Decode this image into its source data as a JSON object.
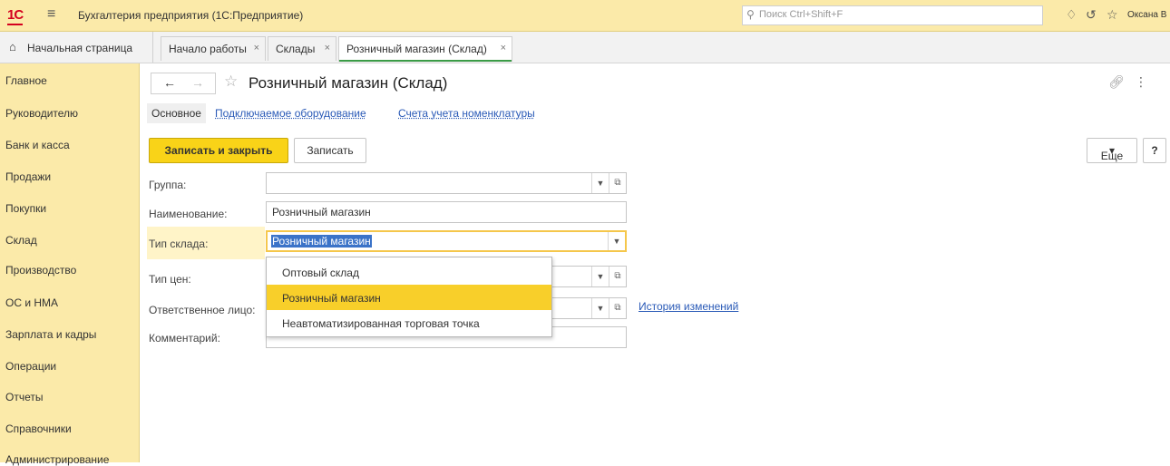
{
  "app": {
    "logo_text": "1С",
    "title": "Бухгалтерия предприятия (1С:Предприятие)",
    "search_placeholder": "Поиск Ctrl+Shift+F",
    "user_name": "Оксана В"
  },
  "tabs": {
    "home_label": "Начальная страница",
    "items": [
      {
        "label": "Начало работы",
        "close": "×"
      },
      {
        "label": "Склады",
        "close": "×"
      },
      {
        "label": "Розничный магазин (Склад)",
        "close": "×"
      }
    ]
  },
  "sidebar": {
    "items": [
      {
        "label": "Главное"
      },
      {
        "label": "Руководителю"
      },
      {
        "label": "Банк и касса"
      },
      {
        "label": "Продажи"
      },
      {
        "label": "Покупки"
      },
      {
        "label": "Склад"
      },
      {
        "label": "Производство"
      },
      {
        "label": "ОС и НМА"
      },
      {
        "label": "Зарплата и кадры"
      },
      {
        "label": "Операции"
      },
      {
        "label": "Отчеты"
      },
      {
        "label": "Справочники"
      },
      {
        "label": "Администрирование"
      }
    ]
  },
  "form": {
    "title": "Розничный магазин (Склад)",
    "section_tabs": {
      "main": "Основное",
      "equipment": "Подключаемое оборудование",
      "accounts": "Счета учета номенклатуры"
    },
    "buttons": {
      "save_close": "Записать и закрыть",
      "save": "Записать",
      "more": "Еще",
      "help": "?"
    },
    "fields": {
      "group_label": "Группа:",
      "group_value": "",
      "name_label": "Наименование:",
      "name_value": "Розничный магазин",
      "warehouse_type_label": "Тип склада:",
      "warehouse_type_value": "Розничный магазин",
      "price_type_label": "Тип цен:",
      "responsible_label": "Ответственное лицо:",
      "comment_label": "Комментарий:"
    },
    "history_link": "История изменений",
    "dropdown_options": [
      {
        "label": "Оптовый склад"
      },
      {
        "label": "Розничный магазин"
      },
      {
        "label": "Неавтоматизированная торговая точка"
      }
    ],
    "dropdown_selected": "Розничный магазин"
  }
}
